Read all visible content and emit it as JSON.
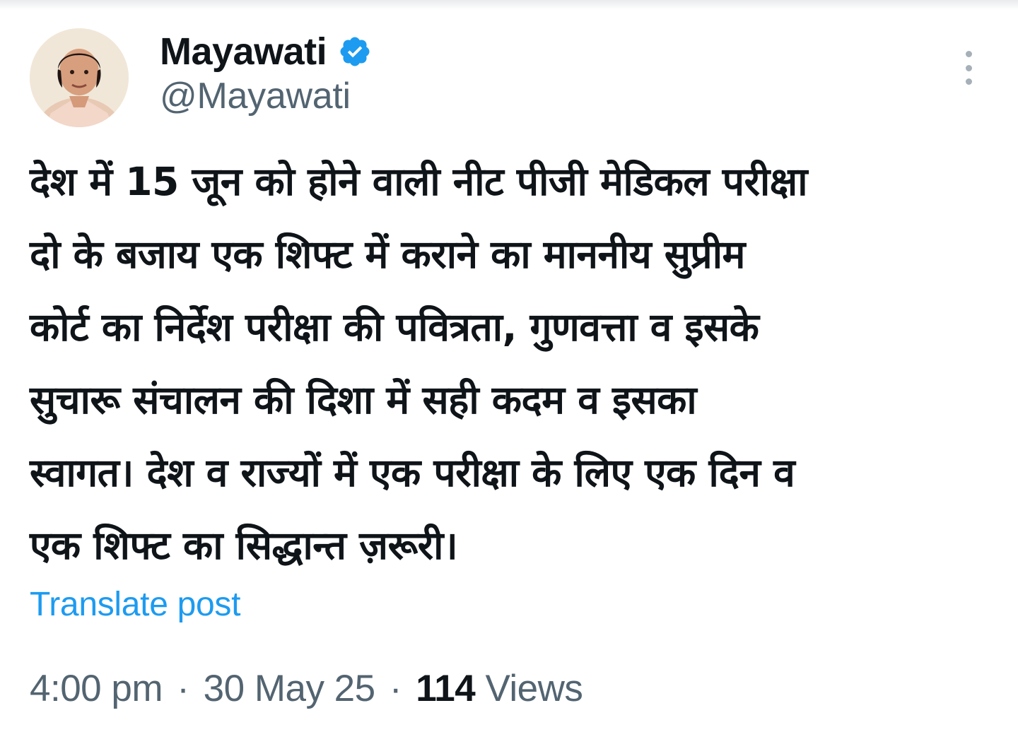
{
  "author": {
    "display_name": "Mayawati",
    "handle": "@Mayawati",
    "verified": true,
    "verified_color": "#1d9bf0",
    "avatar_icon": "profile-photo"
  },
  "post": {
    "text_lines": [
      "देश में 15 जून को होने वाली नीट पीजी मेडिकल परीक्षा",
      "दो के बजाय एक शिफ्ट में कराने का माननीय सुप्रीम",
      "कोर्ट का निर्देश परीक्षा की पवित्रता, गुणवत्ता व इसके",
      "सुचारू संचालन की दिशा में सही कदम व इसका",
      "स्वागत। देश व राज्यों में एक परीक्षा के लिए एक दिन व",
      "एक शिफ्ट का सिद्धान्त ज़रूरी।"
    ],
    "translate_label": "Translate post",
    "time": "4:00 pm",
    "date": "30 May 25",
    "views_count": "114",
    "views_label": "Views",
    "separator": "·"
  },
  "colors": {
    "text": "#0f1419",
    "secondary": "#536471",
    "link": "#1d9bf0"
  },
  "icons": {
    "more": "more-vertical-icon",
    "verified": "verified-badge-icon"
  }
}
